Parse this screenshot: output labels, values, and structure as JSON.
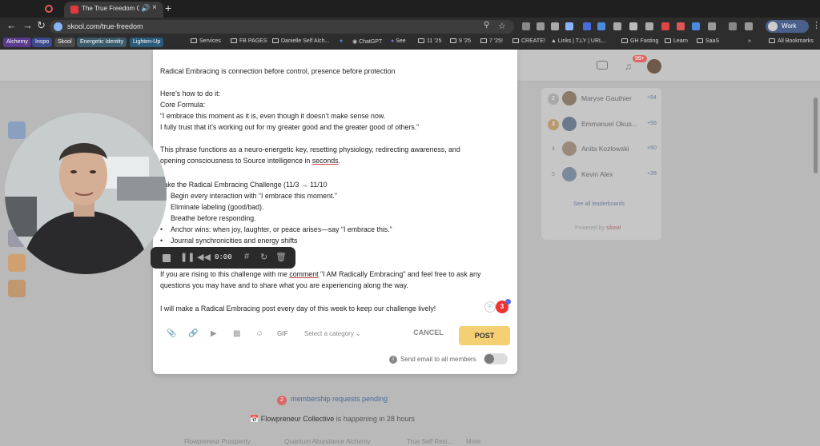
{
  "browser": {
    "tab_title": "The True Freedom Collective",
    "url": "skool.com/true-freedom",
    "profile_name": "Work"
  },
  "bookmarks": [
    {
      "label": "Alchemy"
    },
    {
      "label": "Inspo"
    },
    {
      "label": "Skool"
    },
    {
      "label": "Energetic Identity"
    },
    {
      "label": "Lighten-Up"
    },
    {
      "label": "Services"
    },
    {
      "label": "FB PAGES"
    },
    {
      "label": "Danielle Self Alch..."
    },
    {
      "label": "ChatGPT"
    },
    {
      "label": "See"
    },
    {
      "label": "11 '25"
    },
    {
      "label": "9 '25"
    },
    {
      "label": "7 '25!"
    },
    {
      "label": "CREATE!"
    },
    {
      "label": "Links | T.LY | URL..."
    },
    {
      "label": "GH Fasting"
    },
    {
      "label": "Learn"
    },
    {
      "label": "SaaS"
    },
    {
      "label": "All Bookmarks"
    }
  ],
  "post": {
    "lines": [
      "Radical Embracing is connection before control, presence before protection",
      "",
      "Here's how to do it:",
      "Core Formula:",
      "“I embrace this moment as it is, even though it doesn’t make sense now.",
      "I fully trust that it’s working out for my greater good and the greater good of others.”",
      "",
      "This phrase functions as a neuro-energetic key, resetting physiology, redirecting awareness, and",
      "opening consciousness to Source intelligence in ",
      "",
      "Take the Radical Embracing Challenge (11/3 → 11/10"
    ],
    "underlined_word": "seconds",
    "period_after": ".",
    "bullets": [
      "Begin every interaction with “I embrace this moment.”",
      "Eliminate labeling (good/bad).",
      "Breathe before responding.",
      "Anchor wins: when joy, laughter, or peace arises—say “I embrace this.”",
      "Journal synchronicities and energy shifts"
    ],
    "closing_1_pre": "If you are rising to this challenge with me ",
    "closing_1_word": "comment",
    "closing_1_post": " \"I AM Radically Embracing\" and feel free to ask any",
    "closing_2": "questions you may have and to share what you are experiencing along the way.",
    "closing_3": "I will make a Radical Embracing post every day of this week to keep our challenge lively!"
  },
  "composer": {
    "gif_label": "GIF",
    "category_placeholder": "Select a category",
    "cancel_label": "CANCEL",
    "post_label": "POST",
    "email_label": "Send email to all members",
    "email_toggle_on": false,
    "grammar_count": "3"
  },
  "recorder": {
    "time": "0:00"
  },
  "leaderboard": {
    "rows": [
      {
        "rank": "2",
        "name": "Maryse Gauthier",
        "points": "+54"
      },
      {
        "rank": "3",
        "name": "Emmanuel Okus...",
        "points": "+56"
      },
      {
        "rank": "4",
        "name": "Anita Kozlowski",
        "points": "+50"
      },
      {
        "rank": "5",
        "name": "Kevin Alex",
        "points": "+28"
      }
    ],
    "see_all": "See all leaderboards",
    "powered_by": "Powered by",
    "powered_brand": "skool"
  },
  "header": {
    "notif_badge": "99+"
  },
  "page": {
    "membership_count": "2",
    "membership_text": "membership requests pending",
    "event_name": "Flowpreneur Collective",
    "event_text": " is happening in 28 hours",
    "bottom_pills": [
      "Flowpreneur Prosperity",
      "Quantum Abundance Alchemy",
      "True Self Resi...",
      "More"
    ]
  },
  "colors": {
    "accent_post": "#f5cf73",
    "link_blue": "#4a6a9a",
    "badge_red": "#dd3333"
  }
}
